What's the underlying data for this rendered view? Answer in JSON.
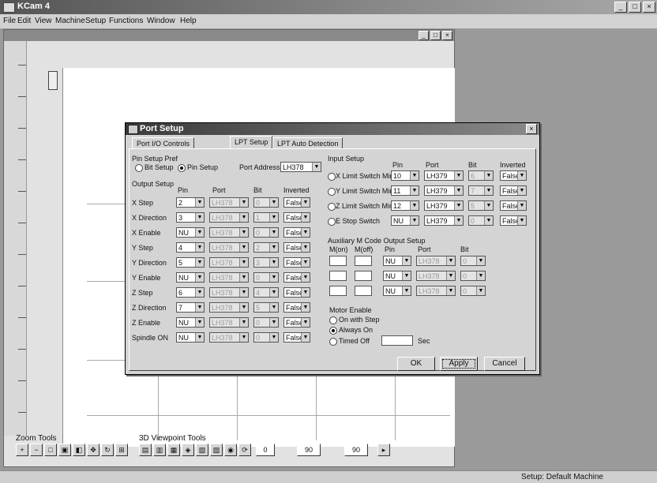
{
  "app": {
    "title": "KCam 4"
  },
  "menu": [
    "File",
    "Edit",
    "View",
    "Machine",
    "Setup",
    "Functions",
    "Window",
    "Help"
  ],
  "window_buttons": [
    "_",
    "□",
    "×"
  ],
  "child_window_buttons": [
    "_",
    "□",
    "×"
  ],
  "toolbar": {
    "zoom_label": "Zoom Tools",
    "viewpoint_label": "3D Viewpoint Tools",
    "fields": [
      "0",
      "90",
      "90"
    ]
  },
  "status": {
    "text": "Setup: Default Machine"
  },
  "dialog": {
    "title": "Port Setup",
    "close": "×",
    "tabs": [
      "Port I/O Controls",
      "LPT Setup",
      "LPT Auto Detection"
    ],
    "pin_setup_pref_label": "Pin Setup Pref",
    "bit_setup_label": "Bit Setup",
    "pin_setup_label": "Pin Setup",
    "port_address_label": "Port Address",
    "port_address_value": "LH378",
    "output_setup_label": "Output Setup",
    "output_headers": [
      "Pin",
      "Port",
      "Bit",
      "Inverted"
    ],
    "outputs": [
      {
        "label": "X Step",
        "pin": "2",
        "port": "LH378",
        "bit": "0",
        "inv": "False"
      },
      {
        "label": "X Direction",
        "pin": "3",
        "port": "LH378",
        "bit": "1",
        "inv": "False"
      },
      {
        "label": "X Enable",
        "pin": "NU",
        "port": "LH378",
        "bit": "0",
        "inv": "False"
      },
      {
        "label": "Y Step",
        "pin": "4",
        "port": "LH378",
        "bit": "2",
        "inv": "False"
      },
      {
        "label": "Y Direction",
        "pin": "5",
        "port": "LH378",
        "bit": "3",
        "inv": "False"
      },
      {
        "label": "Y Enable",
        "pin": "NU",
        "port": "LH378",
        "bit": "0",
        "inv": "False"
      },
      {
        "label": "Z Step",
        "pin": "6",
        "port": "LH378",
        "bit": "4",
        "inv": "False"
      },
      {
        "label": "Z Direction",
        "pin": "7",
        "port": "LH378",
        "bit": "5",
        "inv": "False"
      },
      {
        "label": "Z Enable",
        "pin": "NU",
        "port": "LH378",
        "bit": "0",
        "inv": "False"
      },
      {
        "label": "Spindle ON",
        "pin": "NU",
        "port": "LH378",
        "bit": "0",
        "inv": "False"
      }
    ],
    "input_setup_label": "Input Setup",
    "input_headers": [
      "Pin",
      "Port",
      "Bit",
      "Inverted"
    ],
    "inputs": [
      {
        "label": "X Limit Switch Min",
        "pin": "10",
        "port": "LH379",
        "bit": "6",
        "inv": "False"
      },
      {
        "label": "Y Limit Switch Min",
        "pin": "11",
        "port": "LH379",
        "bit": "7",
        "inv": "False"
      },
      {
        "label": "Z Limit Switch Min",
        "pin": "12",
        "port": "LH379",
        "bit": "5",
        "inv": "False"
      },
      {
        "label": "E Stop Switch",
        "pin": "NU",
        "port": "LH379",
        "bit": "0",
        "inv": "False"
      }
    ],
    "aux_label": "Auxiliary M Code Output Setup",
    "aux_headers": [
      "M(on)",
      "M(off)",
      "Pin",
      "Port",
      "Bit"
    ],
    "aux_rows": [
      {
        "pin": "NU",
        "port": "LH378",
        "bit": "0"
      },
      {
        "pin": "NU",
        "port": "LH378",
        "bit": "0"
      },
      {
        "pin": "NU",
        "port": "LH378",
        "bit": "0"
      }
    ],
    "motor_enable_label": "Motor Enable",
    "motor_options": [
      "On with Step",
      "Always On",
      "Timed Off"
    ],
    "sec_label": "Sec",
    "ok": "OK",
    "apply": "Apply",
    "cancel": "Cancel"
  }
}
